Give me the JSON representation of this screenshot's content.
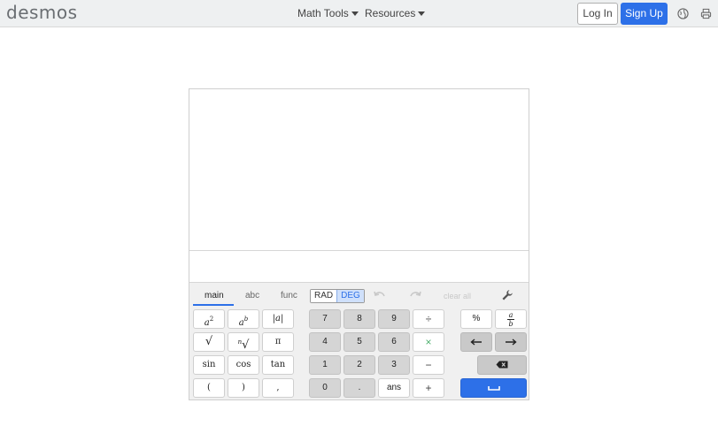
{
  "header": {
    "logo": "desmos",
    "nav": [
      {
        "label": "Math Tools"
      },
      {
        "label": "Resources"
      }
    ],
    "login": "Log In",
    "signup": "Sign Up"
  },
  "keypad": {
    "tabs": [
      "main",
      "abc",
      "func"
    ],
    "active_tab": "main",
    "angle_modes": [
      "RAD",
      "DEG"
    ],
    "active_angle_mode": "DEG",
    "clear_all": "clear all",
    "functions": [
      "a²",
      "aᵇ",
      "|a|",
      "√",
      "ⁿ√",
      "π",
      "sin",
      "cos",
      "tan",
      "(",
      ")",
      ","
    ],
    "numbers": [
      "7",
      "8",
      "9",
      "÷",
      "4",
      "5",
      "6",
      "×",
      "1",
      "2",
      "3",
      "−",
      "0",
      ".",
      "ans",
      "+"
    ],
    "extras": {
      "percent": "%",
      "fraction_num": "a",
      "fraction_den": "b"
    }
  },
  "colors": {
    "accent": "#2d70e8",
    "header_bg": "#eef0f1",
    "keypad_bg": "#f0f0f0",
    "multiply": "#4fb06f"
  },
  "icons": [
    "globe-icon",
    "printer-icon",
    "undo-icon",
    "redo-icon",
    "wrench-icon",
    "left-arrow-icon",
    "right-arrow-icon",
    "backspace-icon",
    "enter-icon"
  ]
}
